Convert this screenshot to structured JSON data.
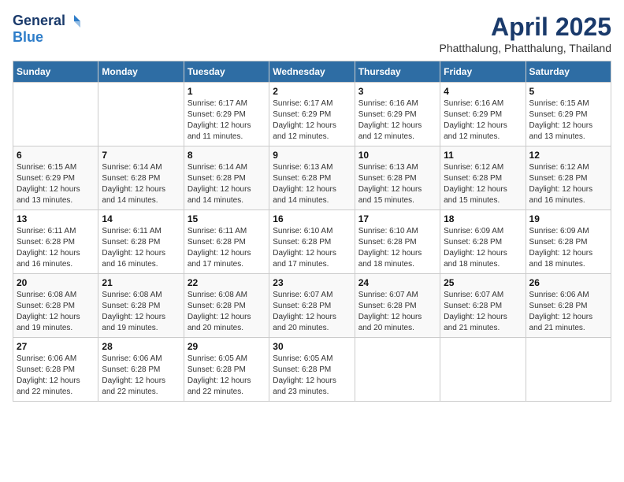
{
  "header": {
    "logo_general": "General",
    "logo_blue": "Blue",
    "title": "April 2025",
    "location": "Phatthalung, Phatthalung, Thailand"
  },
  "calendar": {
    "days_of_week": [
      "Sunday",
      "Monday",
      "Tuesday",
      "Wednesday",
      "Thursday",
      "Friday",
      "Saturday"
    ],
    "weeks": [
      [
        {
          "day": "",
          "sunrise": "",
          "sunset": "",
          "daylight": ""
        },
        {
          "day": "",
          "sunrise": "",
          "sunset": "",
          "daylight": ""
        },
        {
          "day": "1",
          "sunrise": "Sunrise: 6:17 AM",
          "sunset": "Sunset: 6:29 PM",
          "daylight": "Daylight: 12 hours and 11 minutes."
        },
        {
          "day": "2",
          "sunrise": "Sunrise: 6:17 AM",
          "sunset": "Sunset: 6:29 PM",
          "daylight": "Daylight: 12 hours and 12 minutes."
        },
        {
          "day": "3",
          "sunrise": "Sunrise: 6:16 AM",
          "sunset": "Sunset: 6:29 PM",
          "daylight": "Daylight: 12 hours and 12 minutes."
        },
        {
          "day": "4",
          "sunrise": "Sunrise: 6:16 AM",
          "sunset": "Sunset: 6:29 PM",
          "daylight": "Daylight: 12 hours and 12 minutes."
        },
        {
          "day": "5",
          "sunrise": "Sunrise: 6:15 AM",
          "sunset": "Sunset: 6:29 PM",
          "daylight": "Daylight: 12 hours and 13 minutes."
        }
      ],
      [
        {
          "day": "6",
          "sunrise": "Sunrise: 6:15 AM",
          "sunset": "Sunset: 6:29 PM",
          "daylight": "Daylight: 12 hours and 13 minutes."
        },
        {
          "day": "7",
          "sunrise": "Sunrise: 6:14 AM",
          "sunset": "Sunset: 6:28 PM",
          "daylight": "Daylight: 12 hours and 14 minutes."
        },
        {
          "day": "8",
          "sunrise": "Sunrise: 6:14 AM",
          "sunset": "Sunset: 6:28 PM",
          "daylight": "Daylight: 12 hours and 14 minutes."
        },
        {
          "day": "9",
          "sunrise": "Sunrise: 6:13 AM",
          "sunset": "Sunset: 6:28 PM",
          "daylight": "Daylight: 12 hours and 14 minutes."
        },
        {
          "day": "10",
          "sunrise": "Sunrise: 6:13 AM",
          "sunset": "Sunset: 6:28 PM",
          "daylight": "Daylight: 12 hours and 15 minutes."
        },
        {
          "day": "11",
          "sunrise": "Sunrise: 6:12 AM",
          "sunset": "Sunset: 6:28 PM",
          "daylight": "Daylight: 12 hours and 15 minutes."
        },
        {
          "day": "12",
          "sunrise": "Sunrise: 6:12 AM",
          "sunset": "Sunset: 6:28 PM",
          "daylight": "Daylight: 12 hours and 16 minutes."
        }
      ],
      [
        {
          "day": "13",
          "sunrise": "Sunrise: 6:11 AM",
          "sunset": "Sunset: 6:28 PM",
          "daylight": "Daylight: 12 hours and 16 minutes."
        },
        {
          "day": "14",
          "sunrise": "Sunrise: 6:11 AM",
          "sunset": "Sunset: 6:28 PM",
          "daylight": "Daylight: 12 hours and 16 minutes."
        },
        {
          "day": "15",
          "sunrise": "Sunrise: 6:11 AM",
          "sunset": "Sunset: 6:28 PM",
          "daylight": "Daylight: 12 hours and 17 minutes."
        },
        {
          "day": "16",
          "sunrise": "Sunrise: 6:10 AM",
          "sunset": "Sunset: 6:28 PM",
          "daylight": "Daylight: 12 hours and 17 minutes."
        },
        {
          "day": "17",
          "sunrise": "Sunrise: 6:10 AM",
          "sunset": "Sunset: 6:28 PM",
          "daylight": "Daylight: 12 hours and 18 minutes."
        },
        {
          "day": "18",
          "sunrise": "Sunrise: 6:09 AM",
          "sunset": "Sunset: 6:28 PM",
          "daylight": "Daylight: 12 hours and 18 minutes."
        },
        {
          "day": "19",
          "sunrise": "Sunrise: 6:09 AM",
          "sunset": "Sunset: 6:28 PM",
          "daylight": "Daylight: 12 hours and 18 minutes."
        }
      ],
      [
        {
          "day": "20",
          "sunrise": "Sunrise: 6:08 AM",
          "sunset": "Sunset: 6:28 PM",
          "daylight": "Daylight: 12 hours and 19 minutes."
        },
        {
          "day": "21",
          "sunrise": "Sunrise: 6:08 AM",
          "sunset": "Sunset: 6:28 PM",
          "daylight": "Daylight: 12 hours and 19 minutes."
        },
        {
          "day": "22",
          "sunrise": "Sunrise: 6:08 AM",
          "sunset": "Sunset: 6:28 PM",
          "daylight": "Daylight: 12 hours and 20 minutes."
        },
        {
          "day": "23",
          "sunrise": "Sunrise: 6:07 AM",
          "sunset": "Sunset: 6:28 PM",
          "daylight": "Daylight: 12 hours and 20 minutes."
        },
        {
          "day": "24",
          "sunrise": "Sunrise: 6:07 AM",
          "sunset": "Sunset: 6:28 PM",
          "daylight": "Daylight: 12 hours and 20 minutes."
        },
        {
          "day": "25",
          "sunrise": "Sunrise: 6:07 AM",
          "sunset": "Sunset: 6:28 PM",
          "daylight": "Daylight: 12 hours and 21 minutes."
        },
        {
          "day": "26",
          "sunrise": "Sunrise: 6:06 AM",
          "sunset": "Sunset: 6:28 PM",
          "daylight": "Daylight: 12 hours and 21 minutes."
        }
      ],
      [
        {
          "day": "27",
          "sunrise": "Sunrise: 6:06 AM",
          "sunset": "Sunset: 6:28 PM",
          "daylight": "Daylight: 12 hours and 22 minutes."
        },
        {
          "day": "28",
          "sunrise": "Sunrise: 6:06 AM",
          "sunset": "Sunset: 6:28 PM",
          "daylight": "Daylight: 12 hours and 22 minutes."
        },
        {
          "day": "29",
          "sunrise": "Sunrise: 6:05 AM",
          "sunset": "Sunset: 6:28 PM",
          "daylight": "Daylight: 12 hours and 22 minutes."
        },
        {
          "day": "30",
          "sunrise": "Sunrise: 6:05 AM",
          "sunset": "Sunset: 6:28 PM",
          "daylight": "Daylight: 12 hours and 23 minutes."
        },
        {
          "day": "",
          "sunrise": "",
          "sunset": "",
          "daylight": ""
        },
        {
          "day": "",
          "sunrise": "",
          "sunset": "",
          "daylight": ""
        },
        {
          "day": "",
          "sunrise": "",
          "sunset": "",
          "daylight": ""
        }
      ]
    ]
  }
}
